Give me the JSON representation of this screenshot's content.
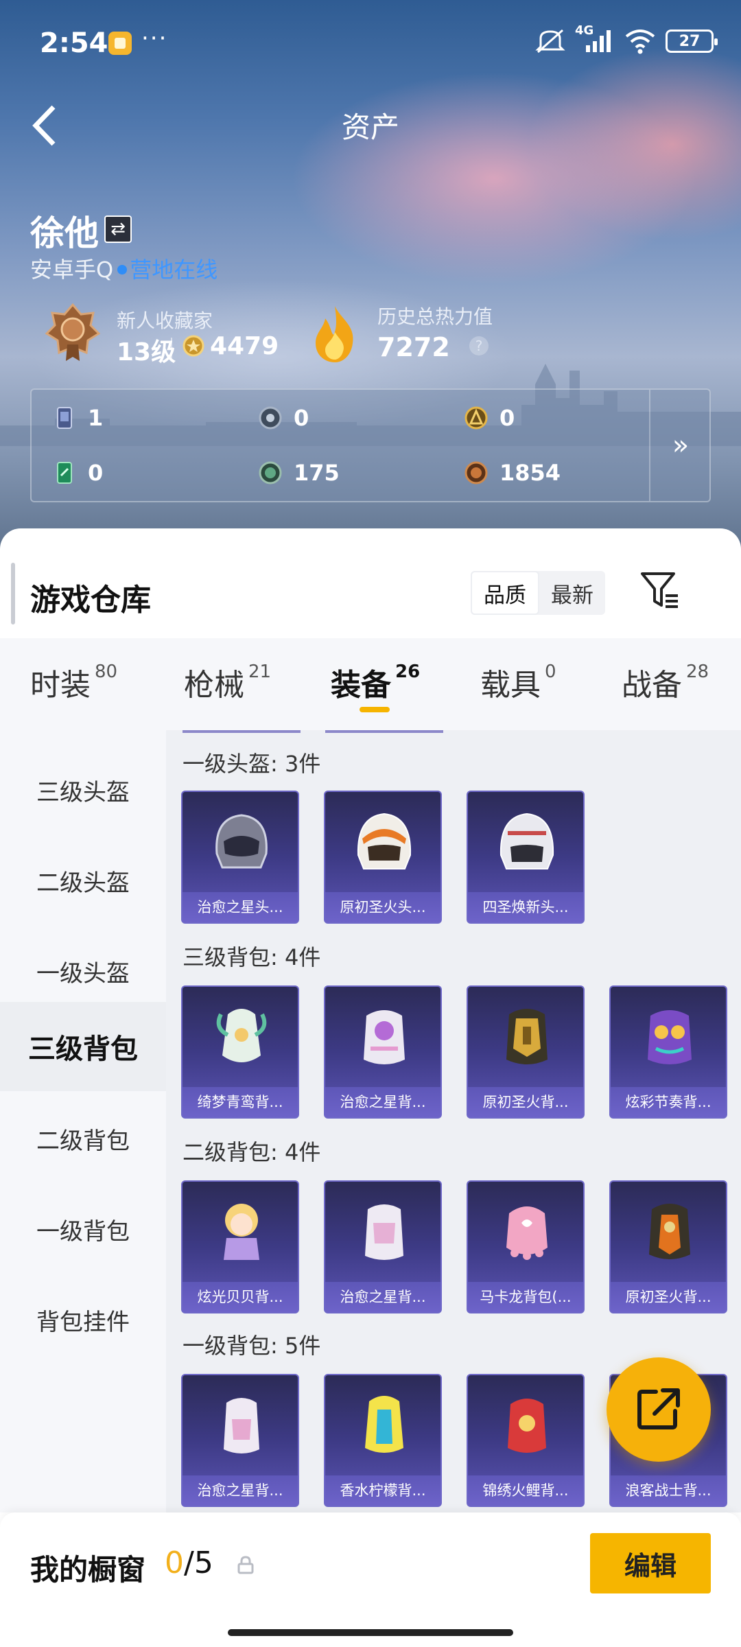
{
  "status_bar": {
    "time": "2:54",
    "dots": "···",
    "network": "4G",
    "battery": "27"
  },
  "header": {
    "title": "资产"
  },
  "profile": {
    "name": "徐他",
    "switch_icon": "⇄",
    "account_type": "安卓手Q",
    "online_status": "营地在线",
    "collector_title": "新人收藏家",
    "collector_level": "13级",
    "coins": "4479",
    "heat_label": "历史总热力值",
    "heat_value": "7272",
    "help": "?"
  },
  "currencies": [
    {
      "icon": "card-icon",
      "value": "1"
    },
    {
      "icon": "gray-coin-icon",
      "value": "0"
    },
    {
      "icon": "gold-coin-icon",
      "value": "0"
    },
    {
      "icon": "ticket-icon",
      "value": "0"
    },
    {
      "icon": "green-orb-icon",
      "value": "175"
    },
    {
      "icon": "bronze-orb-icon",
      "value": "1854"
    }
  ],
  "currency_more": "»",
  "warehouse": {
    "title": "游戏仓库",
    "sort_options": [
      "品质",
      "最新"
    ],
    "sort_selected": "品质"
  },
  "tabs": [
    {
      "label": "时装",
      "count": "80"
    },
    {
      "label": "枪械",
      "count": "21"
    },
    {
      "label": "装备",
      "count": "26"
    },
    {
      "label": "载具",
      "count": "0"
    },
    {
      "label": "战备",
      "count": "28"
    }
  ],
  "active_tab": "装备",
  "side_nav": [
    "三级头盔",
    "二级头盔",
    "一级头盔",
    "三级背包",
    "二级背包",
    "一级背包",
    "背包挂件"
  ],
  "side_nav_active": "三级背包",
  "sections": [
    {
      "title": "一级头盔: 3件",
      "items": [
        "治愈之星头...",
        "原初圣火头...",
        "四圣焕新头..."
      ]
    },
    {
      "title": "三级背包: 4件",
      "items": [
        "绮梦青鸾背...",
        "治愈之星背...",
        "原初圣火背...",
        "炫彩节奏背..."
      ]
    },
    {
      "title": "二级背包: 4件",
      "items": [
        "炫光贝贝背...",
        "治愈之星背...",
        "马卡龙背包(...",
        "原初圣火背..."
      ]
    },
    {
      "title": "一级背包: 5件",
      "items": [
        "治愈之星背...",
        "香水柠檬背...",
        "锦绣火鲤背...",
        "浪客战士背..."
      ]
    }
  ],
  "showcase": {
    "label": "我的橱窗",
    "current": "0",
    "max": "/5",
    "edit": "编辑"
  },
  "colors": {
    "accent": "#f6b500",
    "card_bg": "#3d3a85",
    "online": "#3f97ff"
  }
}
